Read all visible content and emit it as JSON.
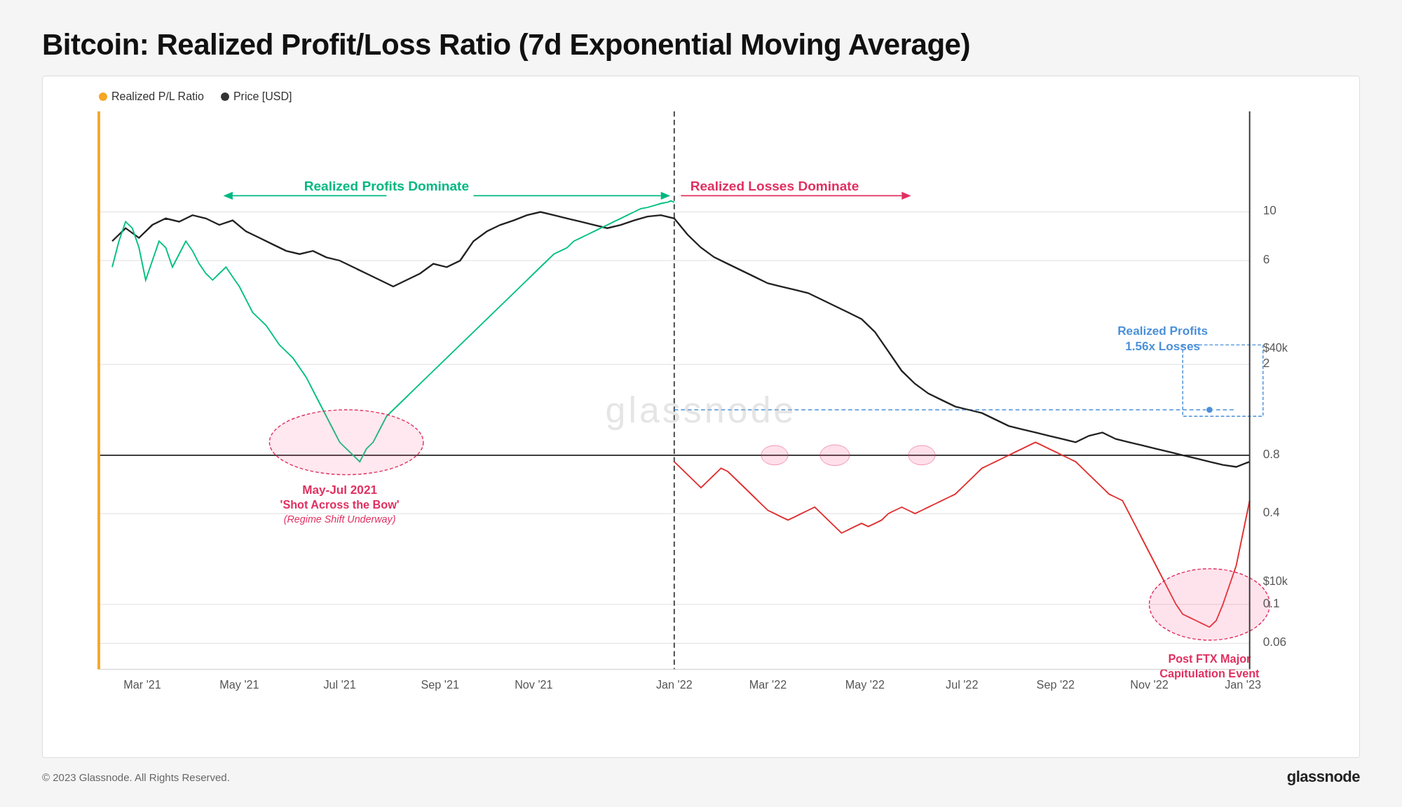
{
  "page": {
    "title": "Bitcoin: Realized Profit/Loss Ratio (7d Exponential Moving Average)",
    "footer_copyright": "© 2023 Glassnode. All Rights Reserved.",
    "footer_logo": "glassnode"
  },
  "legend": {
    "item1_label": "Realized P/L Ratio",
    "item1_color": "#f5a623",
    "item2_label": "Price [USD]",
    "item2_color": "#333333"
  },
  "annotations": {
    "profits_dominate": "Realized Profits Dominate",
    "losses_dominate": "Realized Losses Dominate",
    "may_jul_title": "May-Jul 2021",
    "may_jul_subtitle": "'Shot Across the Bow'",
    "may_jul_italic": "(Regime Shift Underway)",
    "realized_profits_box_line1": "Realized Profits",
    "realized_profits_box_line2": "1.56x Losses",
    "post_ftx_line1": "Post FTX Major",
    "post_ftx_line2": "Capitulation Event",
    "price_40k": "$40k",
    "price_10k": "$10k"
  },
  "y_axis_labels": [
    "0.06",
    "0.1",
    "0.4",
    "0.8",
    "2",
    "6",
    "10"
  ],
  "x_axis_labels": [
    "Mar '21",
    "May '21",
    "Jul '21",
    "Sep '21",
    "Nov '21",
    "Jan '22",
    "Mar '22",
    "May '22",
    "Jul '22",
    "Sep '22",
    "Nov '22",
    "Jan '23"
  ],
  "colors": {
    "green_line": "#00c080",
    "red_line": "#e03030",
    "black_line": "#222222",
    "threshold_line": "#222222",
    "dashed_vertical": "#444444",
    "dashed_horizontal": "#4a90d9",
    "profits_arrow": "#00b880",
    "losses_arrow": "#e03060",
    "pink_fill": "rgba(255,100,150,0.18)",
    "pink_stroke": "#e0306080",
    "blue_box_stroke": "#4a90d9"
  }
}
